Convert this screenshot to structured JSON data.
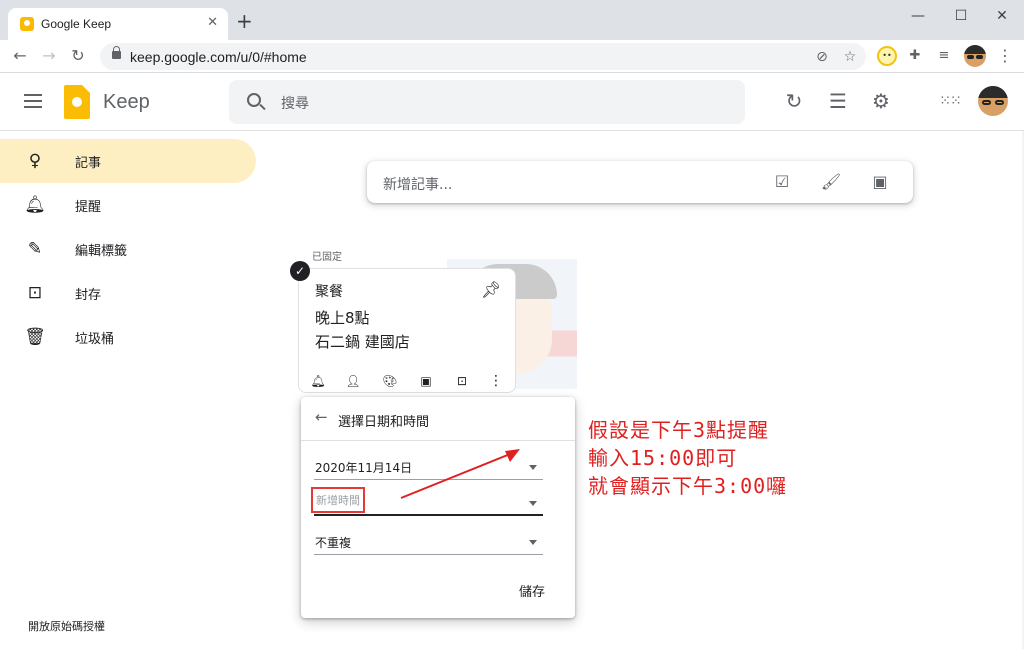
{
  "browser": {
    "tab_title": "Google Keep",
    "tab_close": "✕",
    "new_tab": "+",
    "url": "keep.google.com/u/0/#home",
    "minimize": "—",
    "maximize": "☐",
    "close": "✕"
  },
  "header": {
    "app_name": "Keep",
    "search_placeholder": "搜尋"
  },
  "sidebar": {
    "items": [
      {
        "label": "記事",
        "icon": "lightbulb-icon",
        "active": true
      },
      {
        "label": "提醒",
        "icon": "bell-icon"
      },
      {
        "label": "編輯標籤",
        "icon": "pencil-icon"
      },
      {
        "label": "封存",
        "icon": "archive-icon"
      },
      {
        "label": "垃圾桶",
        "icon": "trash-icon"
      }
    ],
    "license": "開放原始碼授權"
  },
  "take_note": {
    "placeholder": "新增記事..."
  },
  "pinned": {
    "label": "已固定",
    "note": {
      "title": "聚餐",
      "lines": [
        "晚上8點",
        "石二鍋 建國店"
      ]
    }
  },
  "popup": {
    "title": "選擇日期和時間",
    "date_value": "2020年11月14日",
    "time_placeholder": "新增時間",
    "repeat_value": "不重複",
    "save_label": "儲存"
  },
  "annotation": {
    "lines": [
      "假設是下午3點提醒",
      "輸入15:00即可",
      "就會顯示下午3:00囉"
    ],
    "color": "#e02020"
  },
  "colors": {
    "accent": "#fbbc04",
    "active_bg": "#feefc3"
  }
}
